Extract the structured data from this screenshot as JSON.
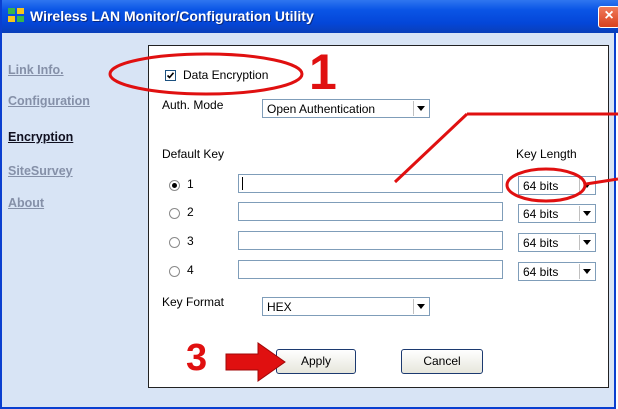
{
  "window": {
    "title": "Wireless LAN Monitor/Configuration Utility",
    "close_glyph": "×"
  },
  "sidebar": {
    "items": [
      {
        "label": "Link Info.",
        "active": false
      },
      {
        "label": "Configuration",
        "active": false
      },
      {
        "label": "Encryption",
        "active": true
      },
      {
        "label": "SiteSurvey",
        "active": false
      },
      {
        "label": "About",
        "active": false
      }
    ]
  },
  "encryption": {
    "data_encryption_label": "Data Encryption",
    "data_encryption_checked": true,
    "auth_mode_label": "Auth. Mode",
    "auth_mode_value": "Open Authentication",
    "default_key_label": "Default Key",
    "key_length_label": "Key Length",
    "keys": [
      {
        "index": "1",
        "selected": true,
        "value": "",
        "length": "64 bits"
      },
      {
        "index": "2",
        "selected": false,
        "value": "",
        "length": "64 bits"
      },
      {
        "index": "3",
        "selected": false,
        "value": "",
        "length": "64 bits"
      },
      {
        "index": "4",
        "selected": false,
        "value": "",
        "length": "64 bits"
      }
    ],
    "key_format_label": "Key Format",
    "key_format_value": "HEX",
    "apply_label": "Apply",
    "cancel_label": "Cancel"
  },
  "annotations": {
    "step1": "1",
    "step3": "3"
  },
  "colors": {
    "titlebar": "#0a55e6",
    "sidebar_bg": "#d8e4f5",
    "callout": "#e01010",
    "active_nav": "#101020",
    "inactive_nav": "#8590a8"
  }
}
